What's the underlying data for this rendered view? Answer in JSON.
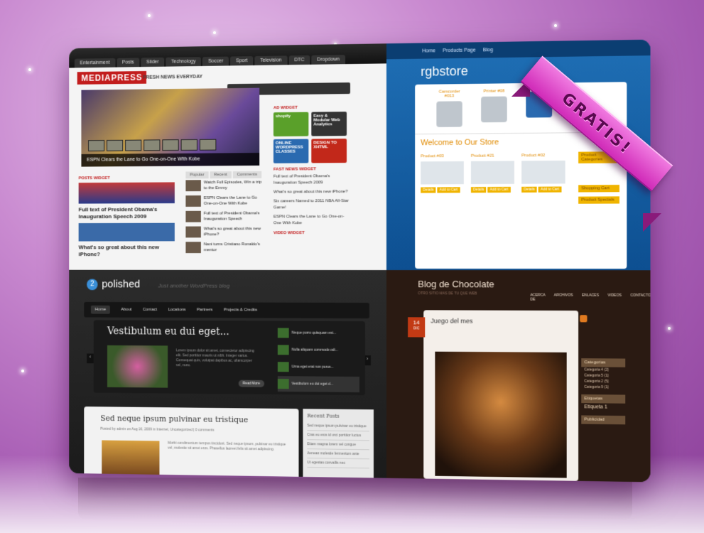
{
  "colors": {
    "background": "#b56cc0",
    "ribbon": "#e04ad0",
    "mediapress_red": "#c21d1d",
    "rgbstore_blue": "#1565b0",
    "chocolate_brown": "#2a1a12"
  },
  "ribbon": {
    "label": "GRATIS!"
  },
  "mediapress": {
    "nav": [
      "Entertainment",
      "Posts",
      "Slider",
      "Technology",
      "Soccer",
      "Sport",
      "Television",
      "DTC",
      "Dropdown"
    ],
    "logo": "MEDIAPRESS",
    "tagline": "FRESH NEWS EVERYDAY",
    "slider_caption": "ESPN Clears the Lane to Go One-on-One With Kobe",
    "posts_widget": "POSTS WIDGET",
    "post1_title": "Full text of President Obama's Inauguration Speech 2009",
    "post2_title": "What's so great about this new iPhone?",
    "ad_widget": "AD WIDGET",
    "ads": [
      "shopify",
      "Easy & Modular Web Analytics",
      "ONLINE WORDPRESS CLASSES",
      "DESIGN TO XHTML"
    ],
    "fast_news": "FAST NEWS WIDGET",
    "fast_news_items": [
      "Full text of President Obama's Inauguration Speech 2009",
      "What's so great about this new iPhone?",
      "Six careers Named to 2011 NBA All-Star Game!",
      "ESPN Clears the Lane to Go One-on-One With Kobe"
    ],
    "video_widget": "VIDEO WIDGET",
    "tabs": [
      "Popular",
      "Recent",
      "Comments"
    ],
    "list_items": [
      "Watch Full Episodes, Win a trip to the Emmy",
      "ESPN Clears the Lane to Go One-on-One With Kobe",
      "Full text of President Obama's Inauguration Speech",
      "What's so great about this new iPhone?",
      "Nani turns Cristiano Ronaldo's mentor"
    ]
  },
  "rgbstore": {
    "top_nav": [
      "Home",
      "Products Page",
      "Blog"
    ],
    "logo": "rgbstore",
    "products_top": [
      "Camcorder #013",
      "Printer #08",
      "",
      ""
    ],
    "welcome": "Welcome to Our Store",
    "products": [
      "Product #03",
      "Product #21",
      "Product #02"
    ],
    "sidebar": [
      "Product Categories",
      "Shopping Cart",
      "Product Specials"
    ],
    "buttons": [
      "Details",
      "Add to Cart"
    ]
  },
  "polished": {
    "badge": "2",
    "logo": "polished",
    "tagline": "Just another WordPress blog",
    "nav": [
      "Home",
      "About",
      "Contact",
      "Locations",
      "Partners",
      "Projects & Credits"
    ],
    "slide_title": "Vestibulum eu dui eget...",
    "slide_text": "Lorem ipsum dolor sit amet, consectetur adipiscing elit. Sed porttitor mauris ut nibh. Integer varius. Consequat quis, volutpat dapibus ac, ullamcorper vel, nunc.",
    "read_more": "Read More",
    "slide_list": [
      "Neque porro quisquam est...",
      "Nulla aliquam commodo odi...",
      "Urna eget erat non purus...",
      "Vestibulum eu dui eget d..."
    ],
    "post_title": "Sed neque ipsum pulvinar eu tristique",
    "post_meta": "Posted by admin on Aug 16, 2009 in Internet, Uncategorized | 0 comments",
    "post_text": "Morbi condimentum tempus tincidunt. Sed neque ipsum, pulvinar eu tristique vel, molestie sit amet eros. Phasellus laoreet felis sit amet adipiscing.",
    "recent_heading": "Recent Posts",
    "recent": [
      "Sed neque ipsum pulvinar eu tristique",
      "Cras eu eros id orci porttitor luctus",
      "Etiam magna lorem vel congue",
      "Aenean molestie fermentum ante",
      "Ut egestas convallis nec"
    ]
  },
  "chocolate": {
    "title": "Blog de Chocolate",
    "subtitle": "OTRO SITIO MAS DE TU QUE WEB",
    "nav": [
      "ACERCA DE",
      "ARCHIVOS",
      "ENLACES",
      "VIDEOS",
      "CONTACTO"
    ],
    "date_day": "14",
    "date_month": "DIC",
    "post_title": "Juego del mes",
    "sidebar_categorias": "Categorias",
    "categorias": [
      "Categoria 4 (2)",
      "Categoria 5 (1)",
      "Categoria 2 (5)",
      "Categoria 9 (1)"
    ],
    "etiquetas": "Etiquetas",
    "etiqueta": "Etiqueta 1",
    "publicidad": "Publicidad"
  }
}
